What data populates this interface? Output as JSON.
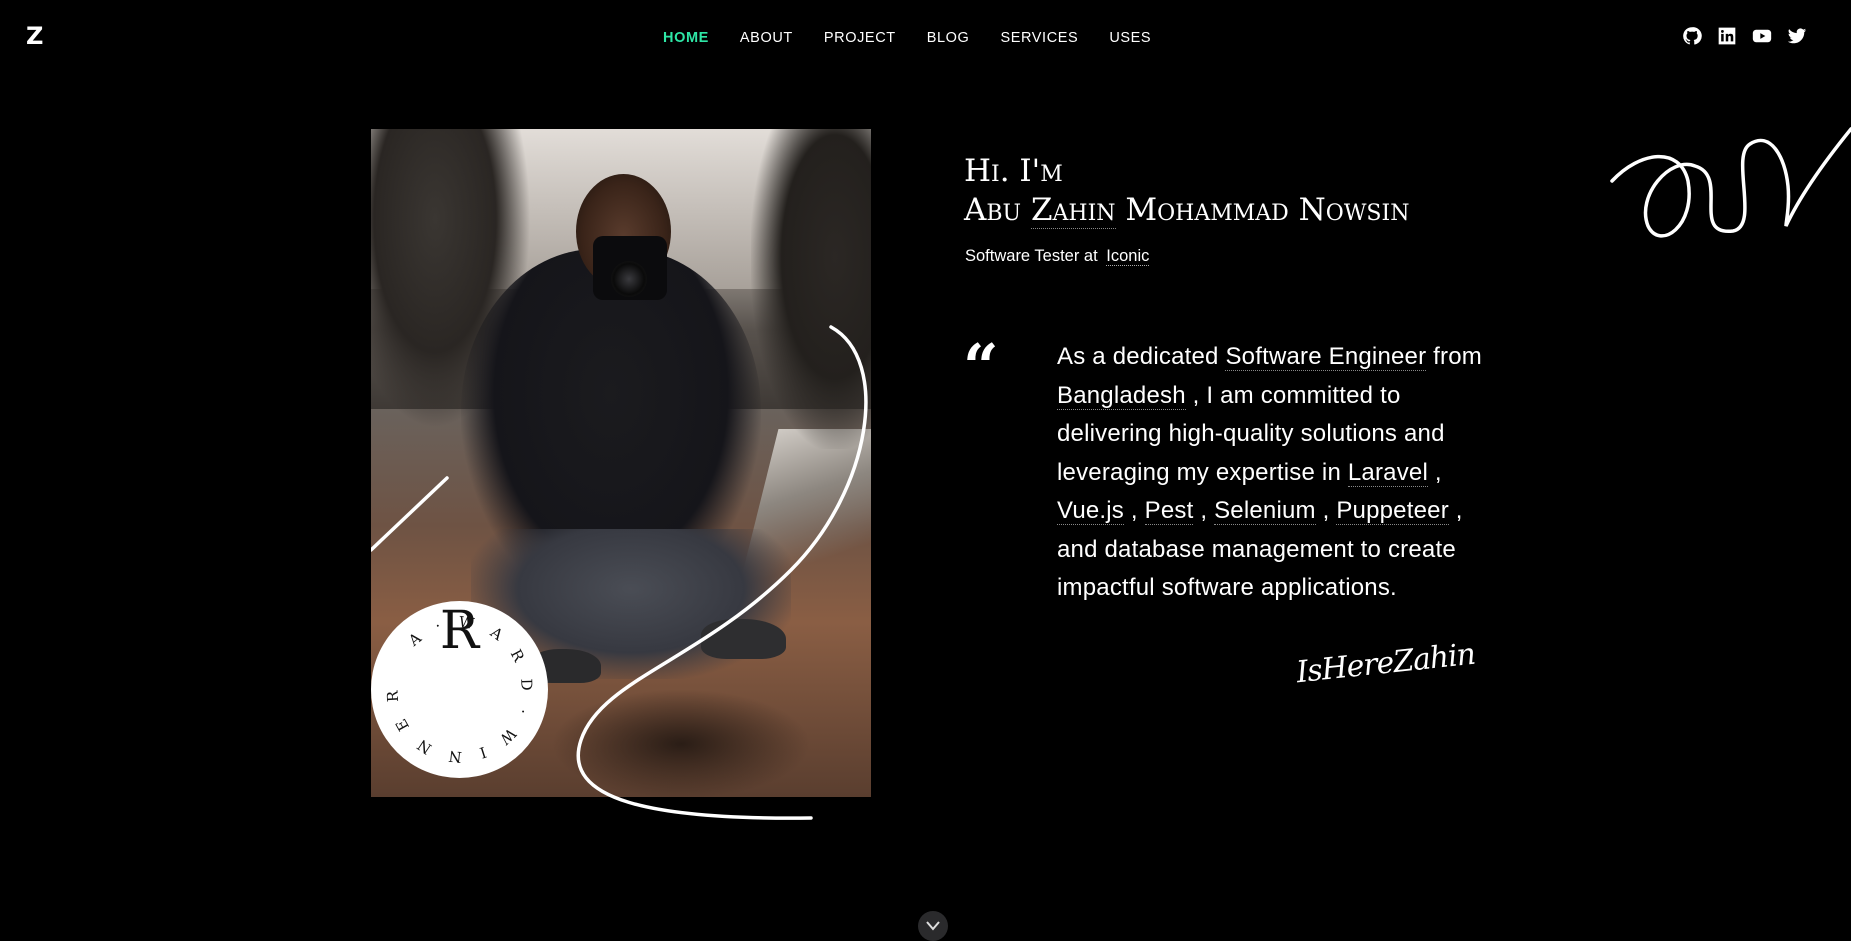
{
  "logo": "Z",
  "nav": [
    {
      "label": "HOME",
      "active": true
    },
    {
      "label": "ABOUT"
    },
    {
      "label": "PROJECT"
    },
    {
      "label": "BLOG"
    },
    {
      "label": "SERVICES"
    },
    {
      "label": "USES"
    }
  ],
  "social": [
    "github-icon",
    "linkedin-icon",
    "youtube-icon",
    "twitter-icon"
  ],
  "hero": {
    "greeting": "Hi. I'm",
    "name_before": "Abu ",
    "name_underlined": "Zahin",
    "name_after": " Mohammad Nowsin",
    "role_prefix": "Software Tester at",
    "company": "Iconic"
  },
  "badge": {
    "letter": "R",
    "ring_text": "A · W A R D · W I N N E R ·"
  },
  "bio": {
    "quote_mark": "“",
    "t1": "As a dedicated ",
    "h1": "Software Engineer",
    "t2": " from ",
    "h2": "Bangladesh",
    "t3": " , I am committed to delivering high-quality solutions and leveraging my expertise in ",
    "h3": "Laravel",
    "t4": " , ",
    "h4": "Vue.js",
    "t5": " , ",
    "h5": "Pest",
    "t6": " , ",
    "h6": "Selenium",
    "t7": " , ",
    "h7": "Puppeteer",
    "t8": " , and database management to create impactful software applications."
  },
  "signature": "IsHereZahin",
  "colors": {
    "accent": "#2ee6a6",
    "background": "#000000"
  }
}
